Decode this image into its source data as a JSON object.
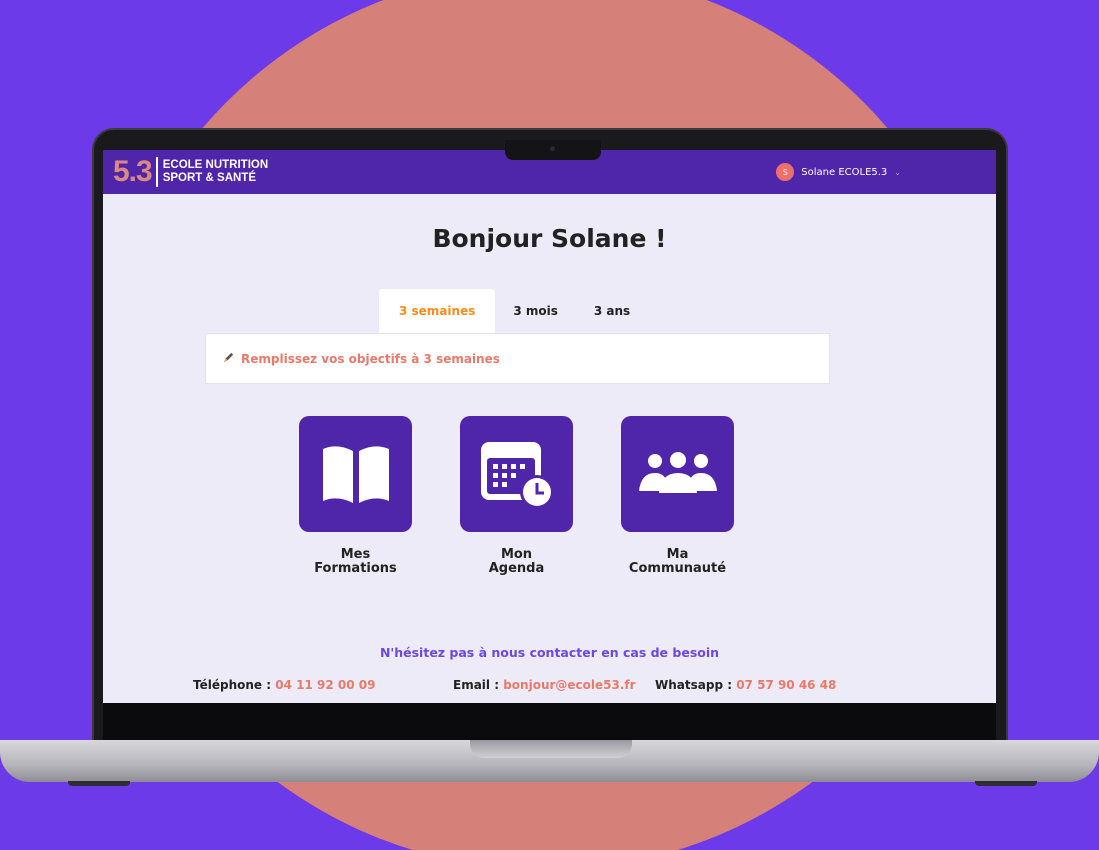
{
  "brand": {
    "number": "5.3",
    "line1": "ECOLE NUTRITION",
    "line2": "SPORT & SANTÉ"
  },
  "user": {
    "avatar_letter": "S",
    "name": "Solane ECOLE5.3"
  },
  "greeting": "Bonjour Solane !",
  "tabs": [
    {
      "label": "3 semaines",
      "active": true
    },
    {
      "label": "3 mois",
      "active": false
    },
    {
      "label": "3 ans",
      "active": false
    }
  ],
  "objective_prompt": "Remplissez vos objectifs à 3 semaines",
  "tiles": [
    {
      "line1": "Mes",
      "line2": "Formations",
      "icon": "book-icon"
    },
    {
      "line1": "Mon",
      "line2": "Agenda",
      "icon": "calendar-clock-icon"
    },
    {
      "line1": "Ma",
      "line2": "Communauté",
      "icon": "group-icon"
    }
  ],
  "contact": {
    "title": "N'hésitez pas à nous contacter en cas de besoin",
    "phone_label": "Téléphone :",
    "phone": "04 11 92 00 09",
    "email_label": "Email :",
    "email": "bonjour@ecole53.fr",
    "whatsapp_label": "Whatsapp :",
    "whatsapp": "07 57 90 46 48"
  },
  "colors": {
    "background": "#6c3ae8",
    "circle": "#d6807a",
    "brand_purple": "#4f25a9",
    "accent_orange": "#ff8a1e",
    "accent_coral": "#e97a6a"
  }
}
